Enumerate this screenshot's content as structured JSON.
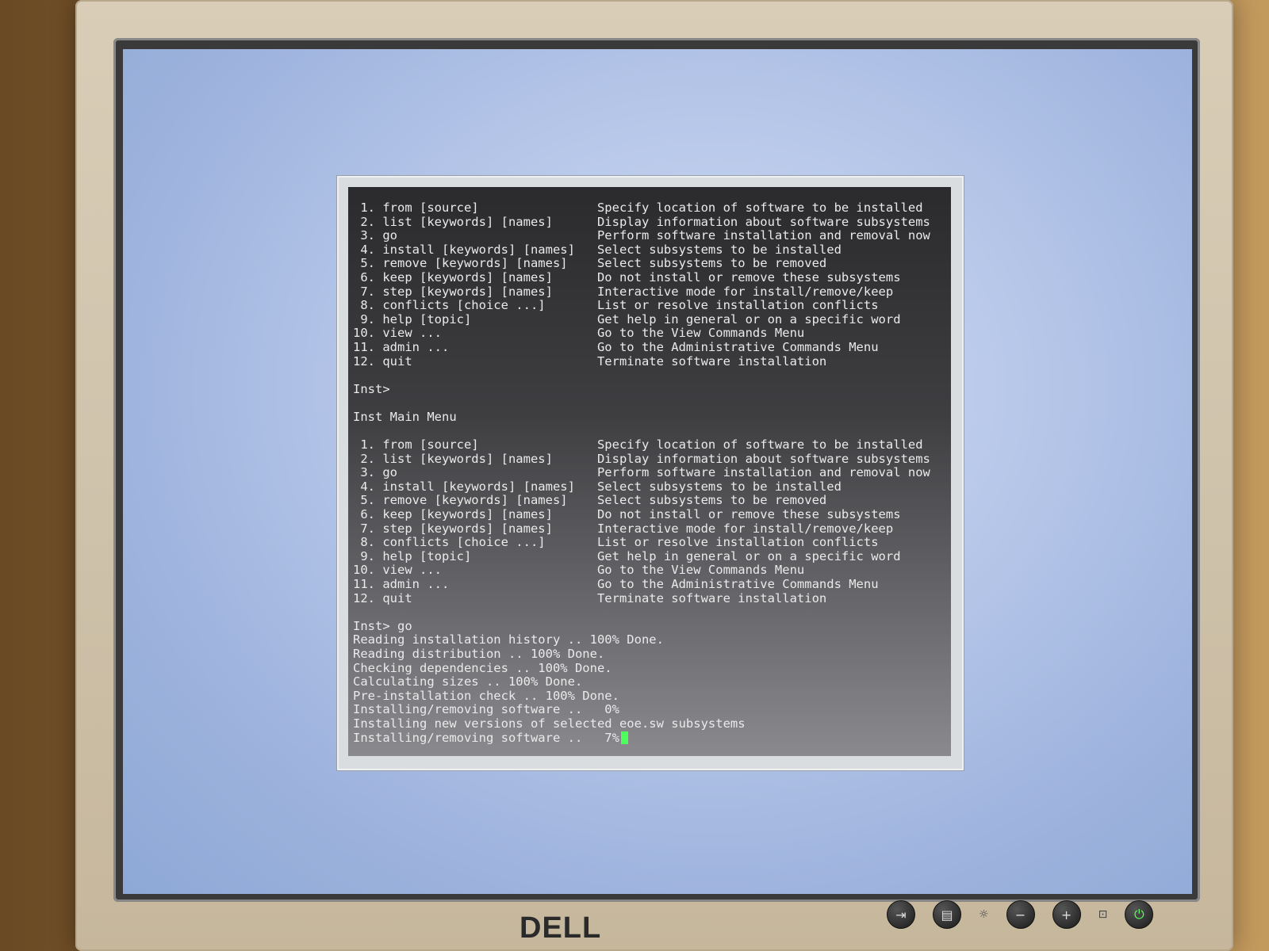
{
  "terminal": {
    "lines": [
      " 1. from [source]                Specify location of software to be installed",
      " 2. list [keywords] [names]      Display information about software subsystems",
      " 3. go                           Perform software installation and removal now",
      " 4. install [keywords] [names]   Select subsystems to be installed",
      " 5. remove [keywords] [names]    Select subsystems to be removed",
      " 6. keep [keywords] [names]      Do not install or remove these subsystems",
      " 7. step [keywords] [names]      Interactive mode for install/remove/keep",
      " 8. conflicts [choice ...]       List or resolve installation conflicts",
      " 9. help [topic]                 Get help in general or on a specific word",
      "10. view ...                     Go to the View Commands Menu",
      "11. admin ...                    Go to the Administrative Commands Menu",
      "12. quit                         Terminate software installation",
      "",
      "Inst>",
      "",
      "Inst Main Menu",
      "",
      " 1. from [source]                Specify location of software to be installed",
      " 2. list [keywords] [names]      Display information about software subsystems",
      " 3. go                           Perform software installation and removal now",
      " 4. install [keywords] [names]   Select subsystems to be installed",
      " 5. remove [keywords] [names]    Select subsystems to be removed",
      " 6. keep [keywords] [names]      Do not install or remove these subsystems",
      " 7. step [keywords] [names]      Interactive mode for install/remove/keep",
      " 8. conflicts [choice ...]       List or resolve installation conflicts",
      " 9. help [topic]                 Get help in general or on a specific word",
      "10. view ...                     Go to the View Commands Menu",
      "11. admin ...                    Go to the Administrative Commands Menu",
      "12. quit                         Terminate software installation",
      "",
      "Inst> go",
      "Reading installation history .. 100% Done.",
      "Reading distribution .. 100% Done.",
      "Checking dependencies .. 100% Done.",
      "Calculating sizes .. 100% Done.",
      "Pre-installation check .. 100% Done.",
      "Installing/removing software ..   0%",
      "Installing new versions of selected eoe.sw subsystems"
    ],
    "active_line": "Installing/removing software ..   7%",
    "cursor_color": "#4dff5a"
  },
  "monitor": {
    "brand": "DELL",
    "buttons": [
      {
        "icon": "input-source-icon",
        "glyph": "⇥"
      },
      {
        "icon": "menu-icon",
        "glyph": "▤"
      },
      {
        "icon": "brightness-icon",
        "glyph": "☼"
      },
      {
        "icon": "minus-icon",
        "glyph": "−"
      },
      {
        "icon": "plus-icon",
        "glyph": "+"
      },
      {
        "icon": "auto-adjust-icon",
        "glyph": "⊡"
      },
      {
        "icon": "power-icon",
        "glyph": "⏻"
      }
    ]
  }
}
